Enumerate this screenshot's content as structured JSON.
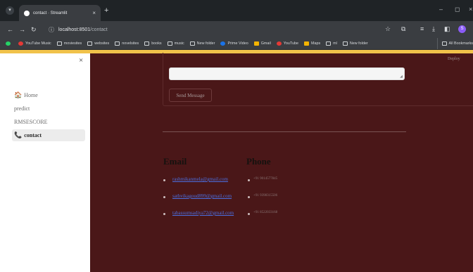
{
  "browser": {
    "tab_title": "contact · Streamlit",
    "tab_close": "×",
    "new_tab": "+",
    "url_host": "localhost:8501",
    "url_path": "/contact"
  },
  "bookmarks": [
    {
      "label": "",
      "icon": "whatsapp-icon"
    },
    {
      "label": "YouTube Music",
      "icon": "youtube-music-icon"
    },
    {
      "label": "moviesites",
      "icon": "folder-icon"
    },
    {
      "label": "websites",
      "icon": "folder-icon"
    },
    {
      "label": "novelsites",
      "icon": "folder-icon"
    },
    {
      "label": "books",
      "icon": "folder-icon"
    },
    {
      "label": "music",
      "icon": "folder-icon"
    },
    {
      "label": "New folder",
      "icon": "folder-icon"
    },
    {
      "label": "Prime Video",
      "icon": "prime-video-icon"
    },
    {
      "label": "Gmail",
      "icon": "gmail-icon"
    },
    {
      "label": "YouTube",
      "icon": "youtube-icon"
    },
    {
      "label": "Maps",
      "icon": "maps-icon"
    },
    {
      "label": "ml",
      "icon": "folder-icon"
    },
    {
      "label": "New folder",
      "icon": "folder-icon"
    }
  ],
  "bookmarks_all": "All Bookmarks",
  "sidebar": {
    "close_icon": "×",
    "items": [
      {
        "label": "Home",
        "icon": "🏠"
      },
      {
        "label": "predict",
        "icon": ""
      },
      {
        "label": "RMSESCORE",
        "icon": ""
      },
      {
        "label": "contact",
        "icon": "📞"
      }
    ]
  },
  "main": {
    "deploy_label": "Deploy",
    "send_button": "Send Message",
    "email_heading": "Email",
    "phone_heading": "Phone",
    "emails": [
      "rashmikanmela@gmail.com",
      "sathvikagoud899@gmail.com",
      "tabassumsadiya72@gmail.com"
    ],
    "phones": [
      "+91 9014577845",
      "+91 9398315506",
      "+91 8522033168"
    ]
  },
  "colors": {
    "main_bg": "#4a1718",
    "sidebar_bg": "#ffffff",
    "link": "#4a6ee0",
    "accent_bar": "#f1c24a"
  }
}
